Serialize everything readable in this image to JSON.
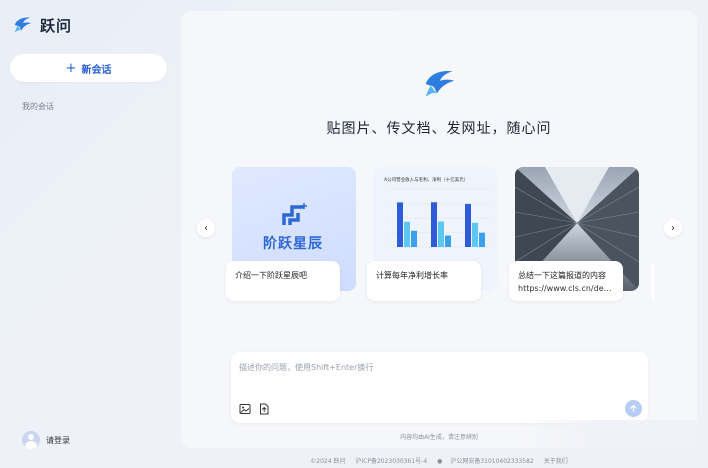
{
  "sidebar": {
    "brand_name": "跃问",
    "new_chat_label": "新会话",
    "my_chats_label": "我的会话",
    "login_label": "请登录"
  },
  "main": {
    "hero_title": "贴图片、传文档、发网址，随心问",
    "cards": [
      {
        "caption": "介绍一下阶跃星辰吧",
        "image_text": "阶跃星辰"
      },
      {
        "caption": "计算每年净利增长率",
        "chart_title": "A公司营业收入与毛利、净利（十亿美元）"
      },
      {
        "caption": "总结一下这篇报道的内容",
        "url": "https://www.cls.cn/det..."
      }
    ],
    "input_placeholder": "描述你的问题，使用Shift+Enter换行",
    "disclaimer": "内容均由AI生成，请注意辨别"
  },
  "footer": {
    "copyright": "©2024 跃问",
    "icp": "沪ICP备2023030361号-4",
    "police": "沪公网安备31010402333582",
    "about": "关于我们"
  },
  "colors": {
    "accent": "#2b5fd9",
    "brand_blue": "#2f68d6",
    "bar_dark": "#2f5bd8",
    "bar_light": "#5ec7f0"
  },
  "chart_data": {
    "type": "bar",
    "title": "A公司营业收入与毛利、净利（十亿美元）",
    "categories": [
      "",
      "",
      ""
    ],
    "series": [
      {
        "values": [
          26.9,
          27.0,
          26.0
        ]
      },
      {
        "values": [
          15.2,
          15.4,
          14.6
        ]
      },
      {
        "values": [
          9.8,
          6.9,
          8.6
        ]
      }
    ],
    "ylim": [
      0,
      35
    ]
  }
}
